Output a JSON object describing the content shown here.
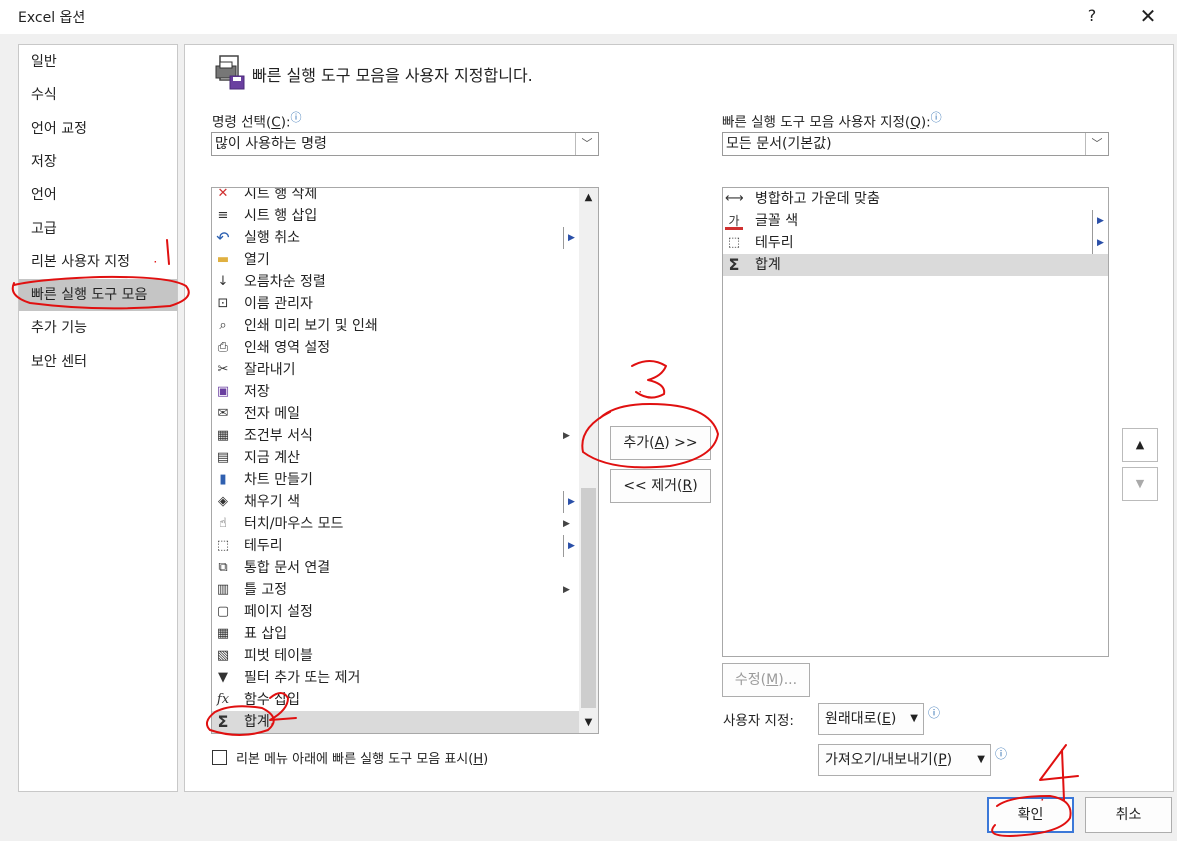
{
  "window": {
    "title": "Excel 옵션",
    "help": "?",
    "close": "✕"
  },
  "sidebar": {
    "items": [
      "일반",
      "수식",
      "언어 교정",
      "저장",
      "언어",
      "고급",
      "리본 사용자 지정",
      "빠른 실행 도구 모음",
      "추가 기능",
      "보안 센터"
    ],
    "selected_index": 7
  },
  "header": {
    "text": "빠른 실행 도구 모음을 사용자 지정합니다."
  },
  "commands": {
    "label_pre": "명령 선택(",
    "label_key": "C",
    "label_post": "):",
    "combo_value": "많이 사용하는 명령",
    "items": [
      {
        "icon": "delete-sheet-row-icon",
        "glyph": "✕",
        "label": "시트 행 삭제",
        "sub": ""
      },
      {
        "icon": "insert-sheet-row-icon",
        "glyph": "≡",
        "label": "시트 행 삽입",
        "sub": ""
      },
      {
        "icon": "undo-icon",
        "glyph": "↶",
        "label": "실행 취소",
        "sub": "boxed"
      },
      {
        "icon": "open-folder-icon",
        "glyph": "▬",
        "label": "열기",
        "sub": ""
      },
      {
        "icon": "sort-ascending-icon",
        "glyph": "↓",
        "label": "오름차순 정렬",
        "sub": ""
      },
      {
        "icon": "name-manager-icon",
        "glyph": "⊡",
        "label": "이름 관리자",
        "sub": ""
      },
      {
        "icon": "print-preview-icon",
        "glyph": "⌕",
        "label": "인쇄 미리 보기 및 인쇄",
        "sub": ""
      },
      {
        "icon": "print-area-icon",
        "glyph": "⎙",
        "label": "인쇄 영역 설정",
        "sub": ""
      },
      {
        "icon": "cut-icon",
        "glyph": "✂",
        "label": "잘라내기",
        "sub": ""
      },
      {
        "icon": "save-icon",
        "glyph": "▣",
        "label": "저장",
        "sub": ""
      },
      {
        "icon": "email-icon",
        "glyph": "✉",
        "label": "전자 메일",
        "sub": ""
      },
      {
        "icon": "conditional-format-icon",
        "glyph": "▦",
        "label": "조건부 서식",
        "sub": "plain"
      },
      {
        "icon": "calculate-now-icon",
        "glyph": "▤",
        "label": "지금 계산",
        "sub": ""
      },
      {
        "icon": "create-chart-icon",
        "glyph": "▮",
        "label": "차트 만들기",
        "sub": ""
      },
      {
        "icon": "fill-color-icon",
        "glyph": "◈",
        "label": "채우기 색",
        "sub": "boxed"
      },
      {
        "icon": "touch-mouse-mode-icon",
        "glyph": "☝",
        "label": "터치/마우스 모드",
        "sub": "plain"
      },
      {
        "icon": "borders-icon",
        "glyph": "⬚",
        "label": "테두리",
        "sub": "boxed"
      },
      {
        "icon": "merge-document-icon",
        "glyph": "⧉",
        "label": "통합 문서 연결",
        "sub": ""
      },
      {
        "icon": "freeze-panes-icon",
        "glyph": "▥",
        "label": "틀 고정",
        "sub": "plain"
      },
      {
        "icon": "page-setup-icon",
        "glyph": "▢",
        "label": "페이지 설정",
        "sub": ""
      },
      {
        "icon": "insert-table-icon",
        "glyph": "▦",
        "label": "표 삽입",
        "sub": ""
      },
      {
        "icon": "pivot-table-icon",
        "glyph": "▧",
        "label": "피벗 테이블",
        "sub": ""
      },
      {
        "icon": "filter-icon",
        "glyph": "▼",
        "label": "필터 추가 또는 제거",
        "sub": ""
      },
      {
        "icon": "function-icon",
        "glyph": "fx",
        "label": "함수 삽입",
        "sub": ""
      },
      {
        "icon": "sum-icon",
        "glyph": "Σ",
        "label": "합계",
        "sub": ""
      }
    ],
    "selected_index": 24
  },
  "buttons": {
    "add_pre": "추가(",
    "add_key": "A",
    "add_post": ") >>",
    "remove_pre": "<< 제거(",
    "remove_key": "R",
    "remove_post": ")",
    "modify_pre": "수정(",
    "modify_key": "M",
    "modify_post": ")...",
    "ok": "확인",
    "cancel": "취소",
    "move_up": "▲",
    "move_down": "▼"
  },
  "qat": {
    "label_pre": "빠른 실행 도구 모음 사용자 지정(",
    "label_key": "Q",
    "label_post": "):",
    "combo_value": "모든 문서(기본값)",
    "items": [
      {
        "icon": "merge-center-icon",
        "glyph": "⟷",
        "label": "병합하고 가운데 맞춤",
        "sub": ""
      },
      {
        "icon": "font-color-icon",
        "glyph": "가",
        "label": "글꼴 색",
        "sub": "boxed"
      },
      {
        "icon": "borders-icon",
        "glyph": "⬚",
        "label": "테두리",
        "sub": "boxed"
      },
      {
        "icon": "sum-icon",
        "glyph": "Σ",
        "label": "합계",
        "sub": ""
      }
    ],
    "selected_index": 3
  },
  "customize": {
    "label": "사용자 지정:",
    "reset_pre": "원래대로(",
    "reset_key": "E",
    "reset_post": ")",
    "import_pre": "가져오기/내보내기(",
    "import_key": "P",
    "import_post": ")"
  },
  "show_below": {
    "pre": "리본 메뉴 아래에 빠른 실행 도구 모음 표시(",
    "key": "H",
    "post": ")",
    "checked": false
  },
  "annotations": [
    "1",
    "2",
    "3",
    "4"
  ],
  "colors": {
    "annotation": "#e01010",
    "selected": "#c5c5c5",
    "primary_border": "#3b78d8",
    "info": "#2b6cb0"
  }
}
